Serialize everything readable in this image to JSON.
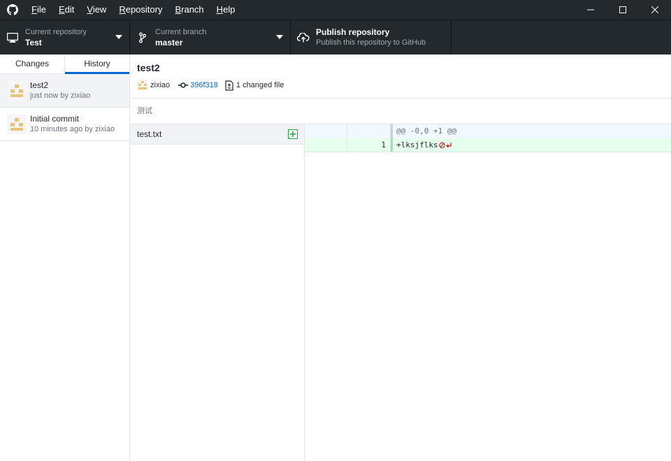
{
  "menu": {
    "items": [
      {
        "accel": "F",
        "rest": "ile"
      },
      {
        "accel": "E",
        "rest": "dit"
      },
      {
        "accel": "V",
        "rest": "iew"
      },
      {
        "accel": "R",
        "rest": "epository"
      },
      {
        "accel": "B",
        "rest": "ranch"
      },
      {
        "accel": "H",
        "rest": "elp"
      }
    ]
  },
  "toolbar": {
    "repo_label": "Current repository",
    "repo_value": "Test",
    "branch_label": "Current branch",
    "branch_value": "master",
    "publish_title": "Publish repository",
    "publish_subtitle": "Publish this repository to GitHub"
  },
  "sidebar": {
    "tabs": [
      {
        "label": "Changes",
        "active": false
      },
      {
        "label": "History",
        "active": true
      }
    ],
    "commits": [
      {
        "title": "test2",
        "meta": "just now by zixiao",
        "selected": true
      },
      {
        "title": "Initial commit",
        "meta": "10 minutes ago by zixiao",
        "selected": false
      }
    ]
  },
  "commit": {
    "summary": "test2",
    "author": "zixiao",
    "sha": "396f318",
    "files_changed": "1 changed file",
    "description": "测试"
  },
  "files": [
    {
      "name": "test.txt",
      "status": "added"
    }
  ],
  "diff": {
    "hunk_header": "@@ -0,0 +1 @@",
    "lines": [
      {
        "old": "",
        "new": "1",
        "text": "+lksjflks"
      }
    ]
  },
  "colors": {
    "chrome": "#24292e",
    "accent": "#0366d6",
    "added": "#28a745",
    "avatar": "#e8c47a"
  }
}
